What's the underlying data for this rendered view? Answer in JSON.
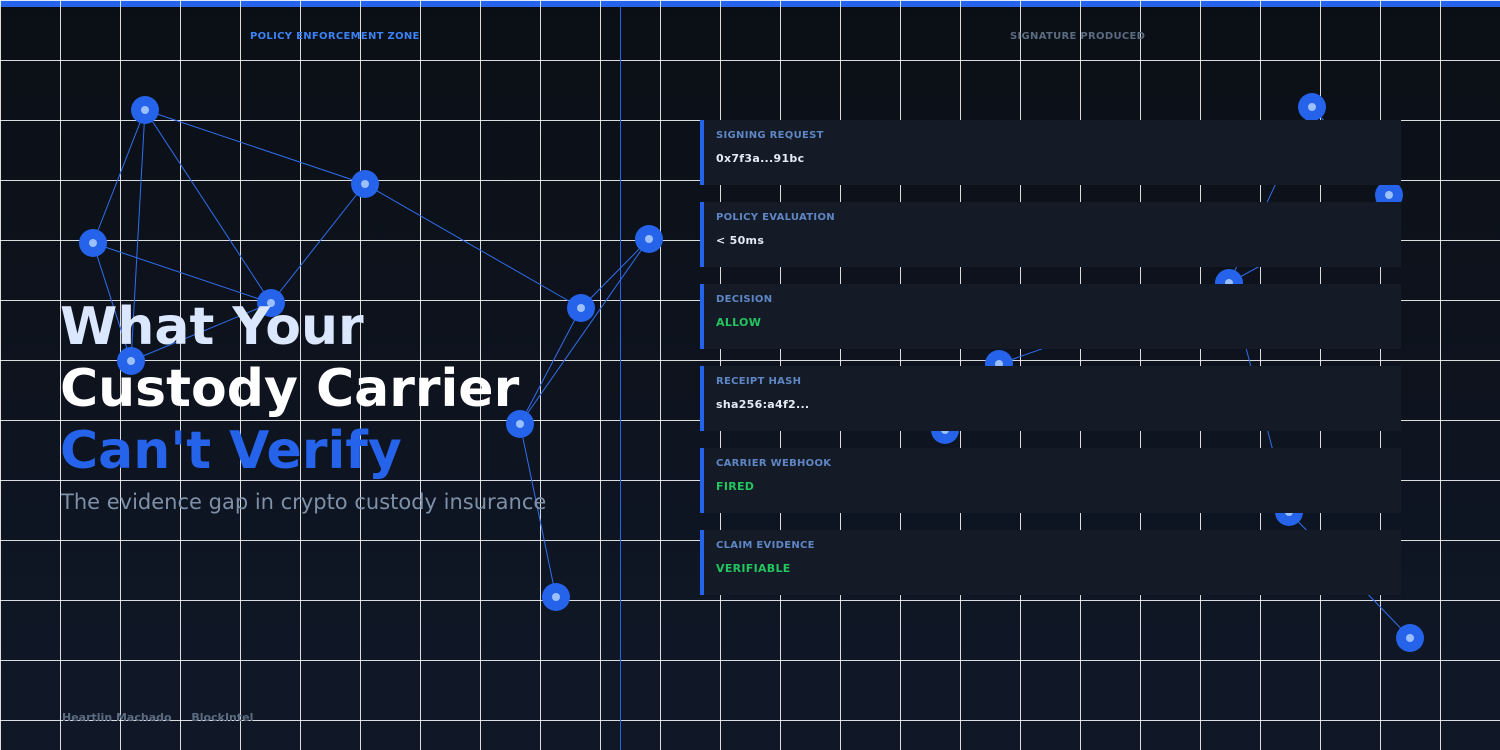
{
  "zones": {
    "left": "POLICY ENFORCEMENT ZONE",
    "right": "SIGNATURE PRODUCED"
  },
  "headline": {
    "line1": "What Your",
    "line2": "Custody Carrier",
    "line3": "Can't Verify"
  },
  "subtitle": "The evidence gap in crypto custody insurance",
  "footer": {
    "author": "Heartlin Machado",
    "org": "BlockIntel"
  },
  "cards": [
    {
      "label": "SIGNING REQUEST",
      "value": "0x7f3a...91bc",
      "status": "neutral"
    },
    {
      "label": "POLICY EVALUATION",
      "value": "< 50ms",
      "status": "neutral"
    },
    {
      "label": "DECISION",
      "value": "ALLOW",
      "status": "ok"
    },
    {
      "label": "RECEIPT HASH",
      "value": "sha256:a4f2...",
      "status": "neutral"
    },
    {
      "label": "CARRIER WEBHOOK",
      "value": "FIRED",
      "status": "ok"
    },
    {
      "label": "CLAIM EVIDENCE",
      "value": "VERIFIABLE",
      "status": "ok"
    }
  ],
  "colors": {
    "accent": "#2563eb",
    "success": "#22c55e",
    "background": "#0b0f15",
    "card": "#141b27"
  }
}
